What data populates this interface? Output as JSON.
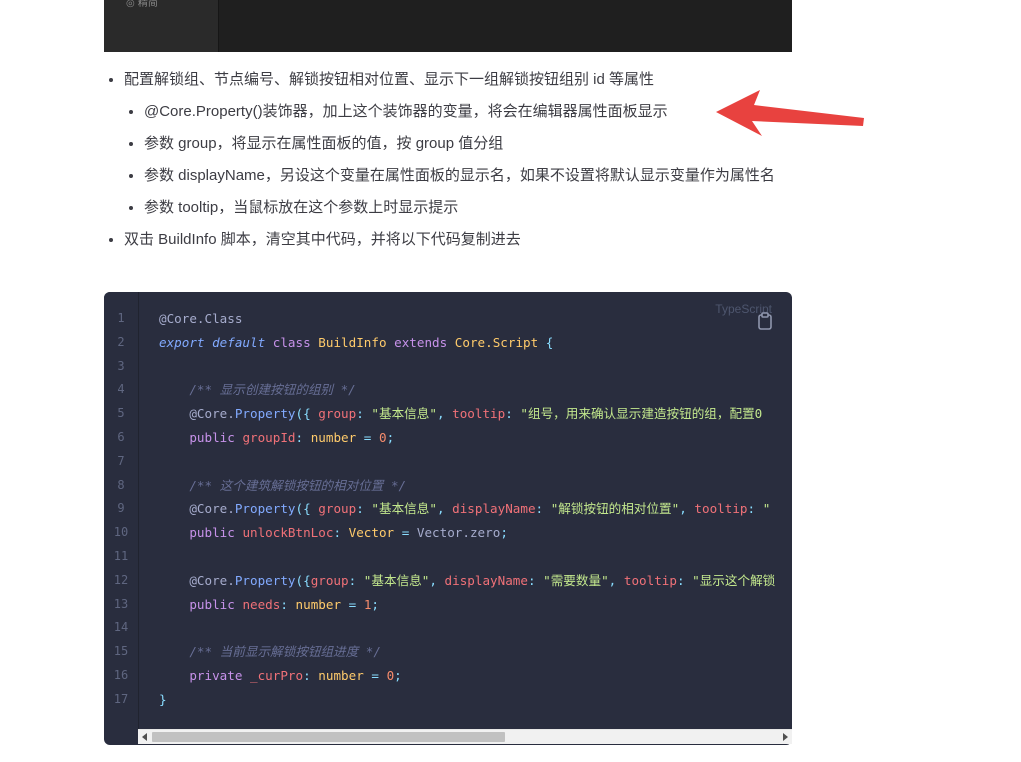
{
  "top_fragment": {
    "text": "◎ 精简"
  },
  "bullets": [
    {
      "text": "配置解锁组、节点编号、解锁按钮相对位置、显示下一组解锁按钮组别 id 等属性",
      "children": [
        "@Core.Property()装饰器，加上这个装饰器的变量，将会在编辑器属性面板显示",
        "参数 group，将显示在属性面板的值，按 group 值分组",
        "参数 displayName，另设这个变量在属性面板的显示名，如果不设置将默认显示变量作为属性名",
        "参数 tooltip，当鼠标放在这个参数上时显示提示"
      ]
    },
    {
      "text": "双击 BuildInfo 脚本，清空其中代码，并将以下代码复制进去"
    }
  ],
  "code": {
    "language_label": "TypeScript",
    "copy_icon": "clipboard-icon",
    "line_numbers": [
      "1",
      "2",
      "3",
      "4",
      "5",
      "6",
      "7",
      "8",
      "9",
      "10",
      "11",
      "12",
      "13",
      "14",
      "15",
      "16",
      "17"
    ],
    "lines": [
      "@Core.Class",
      "export default class BuildInfo extends Core.Script {",
      "",
      "    /** 显示创建按钮的组别 */",
      "    @Core.Property({ group: \"基本信息\", tooltip: \"组号，用来确认显示建造按钮的组，配置0",
      "    public groupId: number = 0;",
      "",
      "    /** 这个建筑解锁按钮的相对位置 */",
      "    @Core.Property({ group: \"基本信息\", displayName: \"解锁按钮的相对位置\", tooltip: \"",
      "    public unlockBtnLoc: Vector = Vector.zero;",
      "",
      "    @Core.Property({group: \"基本信息\", displayName: \"需要数量\", tooltip: \"显示这个解锁",
      "    public needs: number = 1;",
      "",
      "    /** 当前显示解锁按钮组进度 */",
      "    private _curPro: number = 0;",
      "}"
    ]
  },
  "colors": {
    "code_bg": "#292d3e",
    "annotation_arrow": "#e8423f"
  }
}
